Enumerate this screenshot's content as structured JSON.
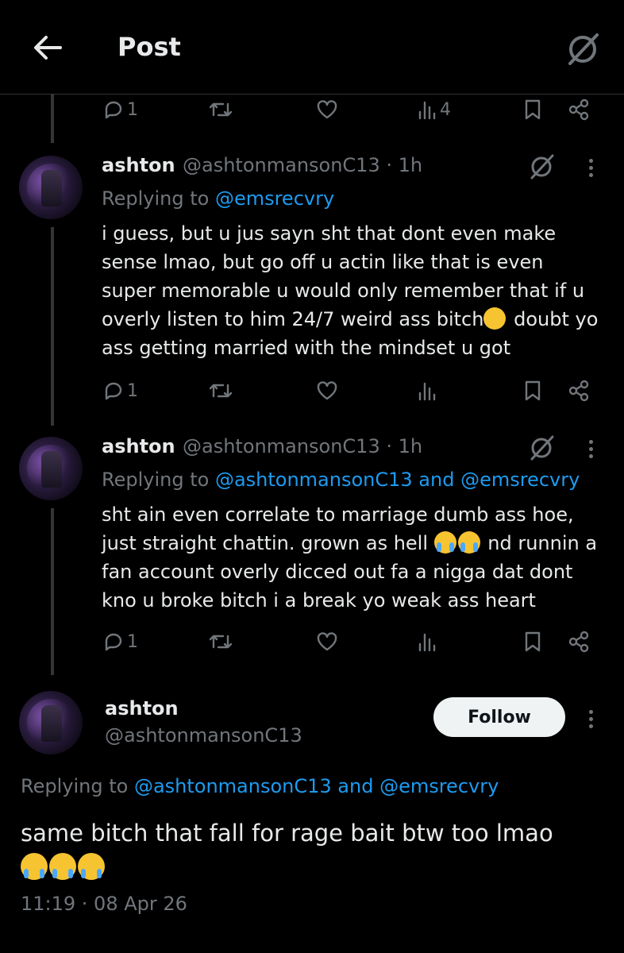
{
  "header": {
    "title": "Post"
  },
  "top_actions": {
    "reply_count": "1",
    "views": "4"
  },
  "tweets": [
    {
      "name": "ashton",
      "handle": "@ashtonmansonC13 · 1h",
      "replying_prefix": "Replying to ",
      "replying_to": "@emsrecvry",
      "lines": [
        "i guess, but u jus sayn sht that dont even make",
        "sense lmao, but go off u actin like that is even",
        "super memorable u would only remember that if u",
        "overly listen to him 24/7 weird ass bitch",
        " doubt yo",
        "ass getting married with the mindset u got"
      ],
      "reply_count": "1"
    },
    {
      "name": "ashton",
      "handle": "@ashtonmansonC13 · 1h",
      "replying_prefix": "Replying to ",
      "replying_to": "@ashtonmansonC13 and @emsrecvry",
      "lines": [
        "sht ain even correlate to marriage dumb ass hoe,",
        "just straight chattin. grown as hell ",
        " nd runnin a",
        "fan account overly dicced out fa a nigga dat dont",
        "kno u broke bitch i a break yo weak ass heart"
      ],
      "reply_count": "1"
    }
  ],
  "main_post": {
    "name": "ashton",
    "handle": "@ashtonmansonC13",
    "follow_label": "Follow",
    "replying_prefix": "Replying to ",
    "replying_to": "@ashtonmansonC13 and @emsrecvry",
    "text": "same bitch that fall for rage bait btw too lmao",
    "timestamp": "11:19 · 08 Apr 26"
  },
  "colors": {
    "accent": "#1d9bf0",
    "muted": "#71767b",
    "text": "#e7e9ea",
    "background": "#000000"
  }
}
